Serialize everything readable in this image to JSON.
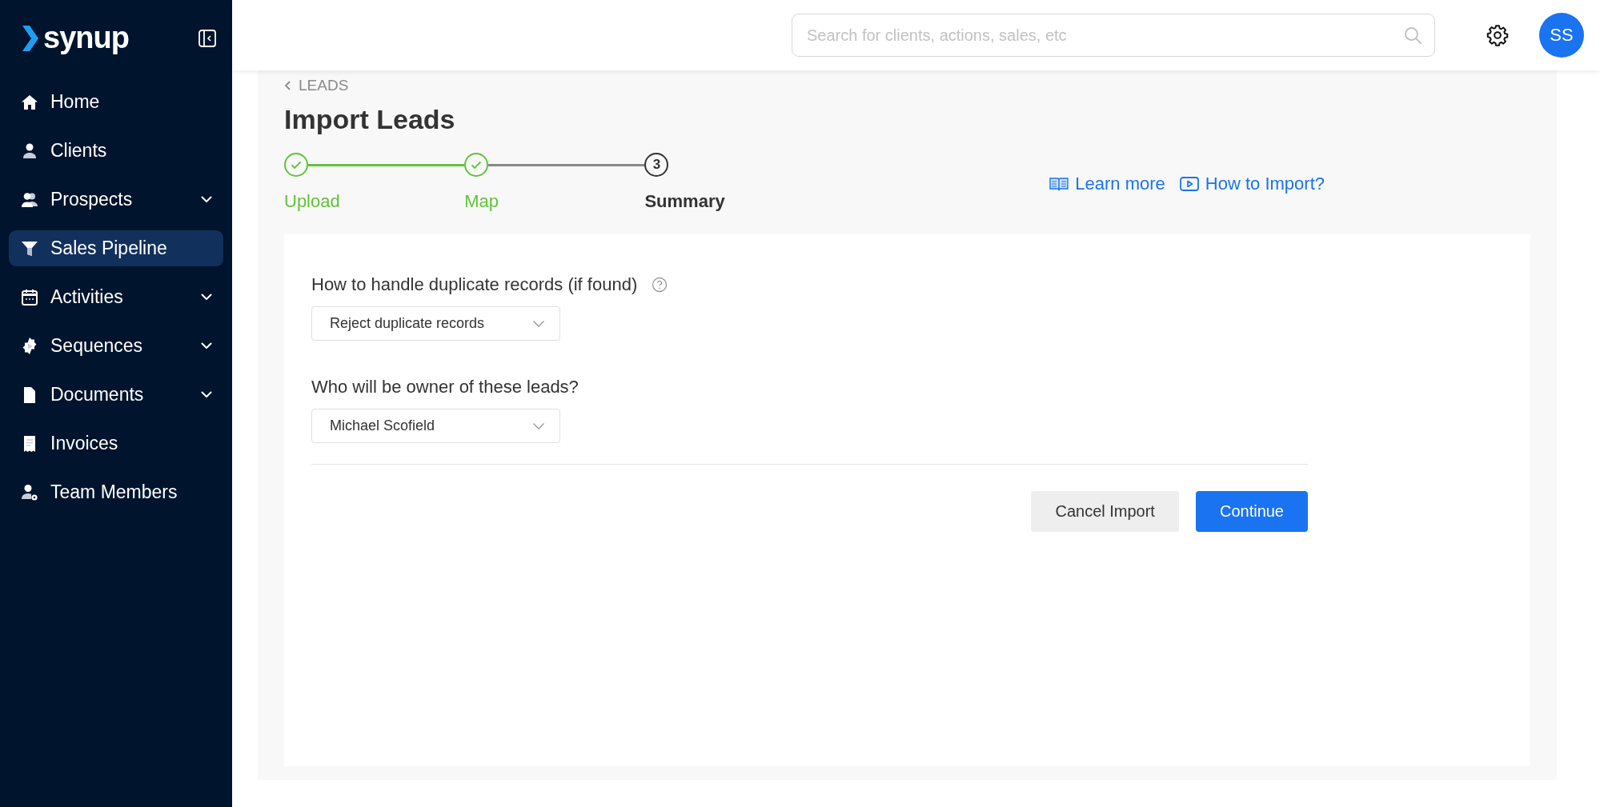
{
  "logo": {
    "text": "synup"
  },
  "sidebar": {
    "items": [
      {
        "label": "Home",
        "selected": false,
        "expandable": false
      },
      {
        "label": "Clients",
        "selected": false,
        "expandable": false
      },
      {
        "label": "Prospects",
        "selected": false,
        "expandable": true
      },
      {
        "label": "Sales Pipeline",
        "selected": true,
        "expandable": false
      },
      {
        "label": "Activities",
        "selected": false,
        "expandable": true
      },
      {
        "label": "Sequences",
        "selected": false,
        "expandable": true
      },
      {
        "label": "Documents",
        "selected": false,
        "expandable": true
      },
      {
        "label": "Invoices",
        "selected": false,
        "expandable": false
      },
      {
        "label": "Team Members",
        "selected": false,
        "expandable": false
      }
    ]
  },
  "header": {
    "search": {
      "placeholder": "Search for clients, actions, sales, etc"
    },
    "avatar": "SS"
  },
  "breadcrumb": "LEADS",
  "title": "Import Leads",
  "steps": [
    {
      "label": "Upload",
      "kind": "done"
    },
    {
      "label": "Map",
      "kind": "done"
    },
    {
      "label": "Summary",
      "number": "3",
      "kind": "current"
    }
  ],
  "links": [
    {
      "label": "Learn more"
    },
    {
      "label": "How to Import?"
    }
  ],
  "form": {
    "fields": [
      {
        "label": "How to handle duplicate records (if found)",
        "help": true,
        "value": "Reject duplicate records"
      },
      {
        "label": "Who will be owner of these leads?",
        "help": false,
        "value": "Michael Scofield"
      }
    ],
    "buttons": [
      {
        "label": "Cancel Import",
        "kind": "secondary"
      },
      {
        "label": "Continue",
        "kind": "primary"
      }
    ]
  }
}
